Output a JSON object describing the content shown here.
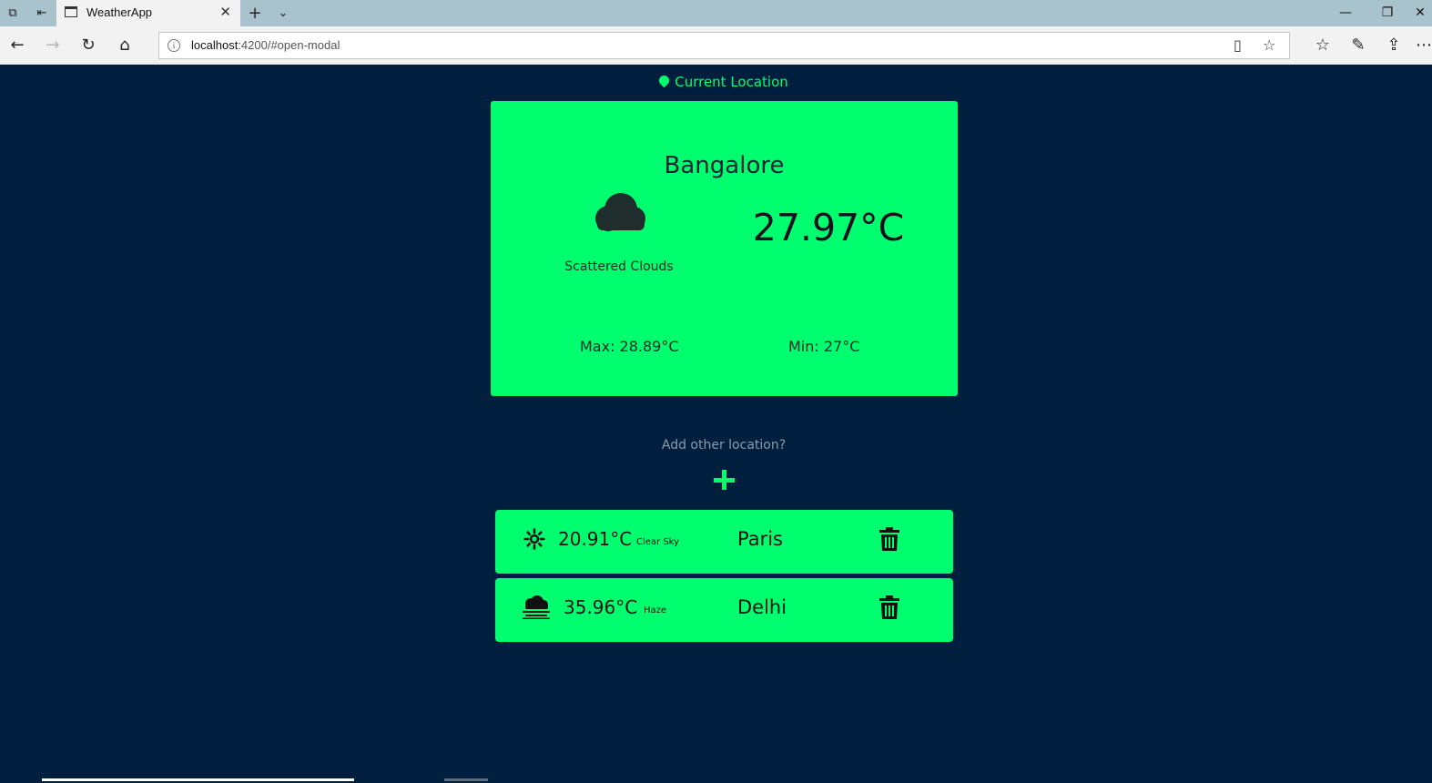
{
  "browser": {
    "tab_title": "WeatherApp",
    "url_host": "localhost",
    "url_rest": ":4200/#open-modal"
  },
  "current_location": {
    "label": "Current Location",
    "city": "Bangalore",
    "condition": "Scattered Clouds",
    "condition_icon": "cloud-icon",
    "temperature": "27.97°C",
    "max": "Max: 28.89°C",
    "min": "Min: 27°C"
  },
  "add_location": {
    "label": "Add other location?"
  },
  "locations": [
    {
      "temperature": "20.91°C",
      "condition": "Clear Sky",
      "icon": "sun-icon",
      "city": "Paris"
    },
    {
      "temperature": "35.96°C",
      "condition": "Haze",
      "icon": "haze-icon",
      "city": "Delhi"
    }
  ],
  "colors": {
    "background": "#001f3f",
    "accent": "#00ff6e"
  }
}
